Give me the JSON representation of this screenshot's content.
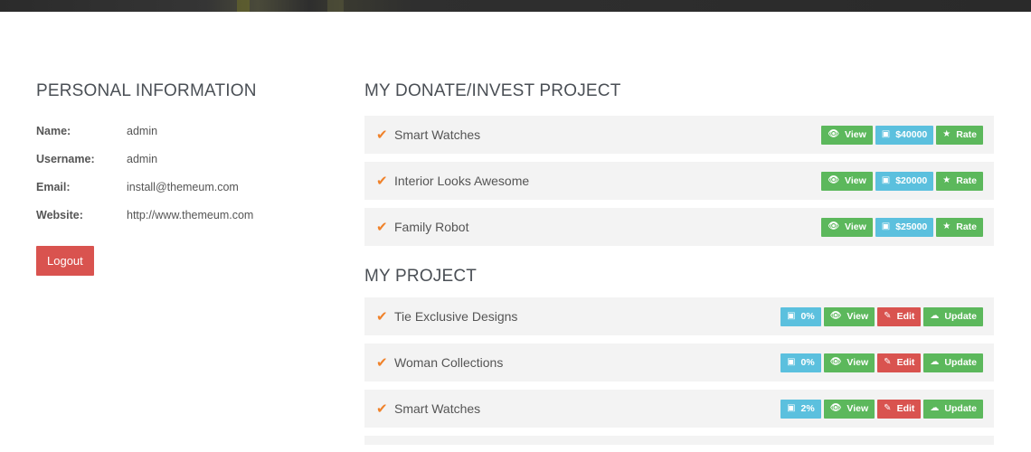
{
  "personal": {
    "title": "PERSONAL INFORMATION",
    "fields": [
      {
        "label": "Name:",
        "value": "admin"
      },
      {
        "label": "Username:",
        "value": "admin"
      },
      {
        "label": "Email:",
        "value": "install@themeum.com"
      },
      {
        "label": "Website:",
        "value": "http://www.themeum.com"
      }
    ],
    "logout_label": "Logout"
  },
  "donate": {
    "title": "MY DONATE/INVEST PROJECT",
    "rows": [
      {
        "name": "Smart Watches",
        "view": "View",
        "amount": "$40000",
        "rate": "Rate"
      },
      {
        "name": "Interior Looks Awesome",
        "view": "View",
        "amount": "$20000",
        "rate": "Rate"
      },
      {
        "name": "Family Robot",
        "view": "View",
        "amount": "$25000",
        "rate": "Rate"
      }
    ]
  },
  "projects": {
    "title": "MY PROJECT",
    "rows": [
      {
        "name": "Tie Exclusive Designs",
        "progress": "0%",
        "view": "View",
        "edit": "Edit",
        "update": "Update"
      },
      {
        "name": "Woman Collections",
        "progress": "0%",
        "view": "View",
        "edit": "Edit",
        "update": "Update"
      },
      {
        "name": "Smart Watches",
        "progress": "2%",
        "view": "View",
        "edit": "Edit",
        "update": "Update"
      }
    ]
  },
  "icons": {
    "check": "check-icon",
    "view": "eye-icon",
    "money": "money-icon",
    "rate": "star-icon",
    "edit": "pencil-icon",
    "update": "cloud-upload-icon"
  },
  "colors": {
    "green": "#5cb85c",
    "blue": "#5bc0de",
    "red": "#d9534f",
    "check": "#f0822a"
  }
}
